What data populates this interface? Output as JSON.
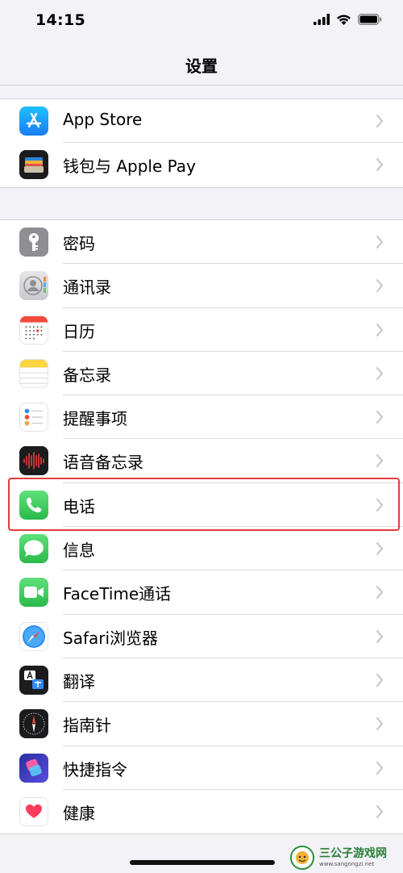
{
  "status_bar": {
    "time": "14:15",
    "icons": [
      "cellular-signal-icon",
      "wifi-icon",
      "battery-icon"
    ]
  },
  "nav": {
    "title": "设置"
  },
  "groups": [
    {
      "items": [
        {
          "label": "App Store",
          "icon": "app-store-icon",
          "color": "#1a8cff"
        },
        {
          "label": "钱包与 Apple Pay",
          "icon": "wallet-icon",
          "color": "#1c1c1e"
        }
      ]
    },
    {
      "items": [
        {
          "label": "密码",
          "icon": "key-icon",
          "color": "#8e8e93"
        },
        {
          "label": "通讯录",
          "icon": "contacts-icon",
          "color": "#cfcfd4"
        },
        {
          "label": "日历",
          "icon": "calendar-icon",
          "color": "#ffffff"
        },
        {
          "label": "备忘录",
          "icon": "notes-icon",
          "color": "#ffffff"
        },
        {
          "label": "提醒事项",
          "icon": "reminders-icon",
          "color": "#ffffff"
        },
        {
          "label": "语音备忘录",
          "icon": "voice-memos-icon",
          "color": "#1c1c1e"
        },
        {
          "label": "电话",
          "icon": "phone-icon",
          "color": "#34c759",
          "highlighted": true
        },
        {
          "label": "信息",
          "icon": "messages-icon",
          "color": "#34c759"
        },
        {
          "label": "FaceTime通话",
          "icon": "facetime-icon",
          "color": "#34c759"
        },
        {
          "label": "Safari浏览器",
          "icon": "safari-icon",
          "color": "#ffffff"
        },
        {
          "label": "翻译",
          "icon": "translate-icon",
          "color": "#1c1c1e"
        },
        {
          "label": "指南针",
          "icon": "compass-icon",
          "color": "#1c1c1e"
        },
        {
          "label": "快捷指令",
          "icon": "shortcuts-icon",
          "color": "#4b3fd0"
        },
        {
          "label": "健康",
          "icon": "health-icon",
          "color": "#ffffff"
        }
      ]
    }
  ],
  "watermark": {
    "title": "三公子游戏网",
    "url": "www.sangongzi.net"
  }
}
